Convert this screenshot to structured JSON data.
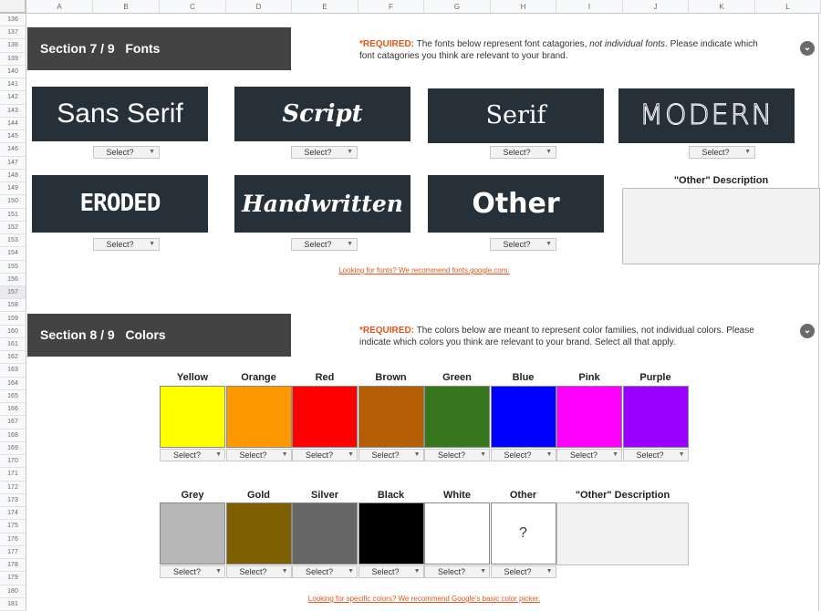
{
  "spreadsheet": {
    "columns": [
      "A",
      "B",
      "C",
      "D",
      "E",
      "F",
      "G",
      "H",
      "I",
      "J",
      "K",
      "L"
    ],
    "rows": [
      "136",
      "137",
      "138",
      "139",
      "140",
      "141",
      "142",
      "143",
      "144",
      "145",
      "146",
      "147",
      "148",
      "149",
      "150",
      "151",
      "152",
      "153",
      "154",
      "155",
      "156",
      "157",
      "158",
      "159",
      "160",
      "161",
      "162",
      "163",
      "164",
      "165",
      "166",
      "167",
      "168",
      "169",
      "170",
      "171",
      "172",
      "173",
      "174",
      "175",
      "176",
      "177",
      "178",
      "179",
      "180",
      "181"
    ],
    "selected_row": "157"
  },
  "fonts_section": {
    "title": "Section 7 / 9   Fonts",
    "required_label": "*REQUIRED:",
    "required_text_1": " The fonts below represent font catagories, ",
    "required_text_italic": "not individual fonts",
    "required_text_2": ". Please indicate which font catagories you think are relevant to your brand.",
    "expand_icon": "chevron-down-circle-icon",
    "categories": [
      {
        "label": "Sans Serif",
        "select": "Select?"
      },
      {
        "label": "Script",
        "select": "Select?"
      },
      {
        "label": "Serif",
        "select": "Select?"
      },
      {
        "label": "MODERN",
        "select": "Select?"
      },
      {
        "label": "ERODED",
        "select": "Select?"
      },
      {
        "label": "Handwritten",
        "select": "Select?"
      },
      {
        "label": "Other",
        "select": "Select?"
      }
    ],
    "other_description_title": "\"Other\" Description",
    "other_description_value": "",
    "link_text": "Looking for fonts? We recommend fonts.google.com."
  },
  "colors_section": {
    "title": "Section 8 / 9   Colors",
    "required_label": "*REQUIRED:",
    "required_text": " The colors below are meant to represent color families, not individual colors. Please indicate which colors you think are relevant to your brand. Select all that apply.",
    "expand_icon": "chevron-down-circle-icon",
    "row1": [
      {
        "name": "Yellow",
        "color": "#ffff00",
        "select": "Select?"
      },
      {
        "name": "Orange",
        "color": "#ff9900",
        "select": "Select?"
      },
      {
        "name": "Red",
        "color": "#ff0000",
        "select": "Select?"
      },
      {
        "name": "Brown",
        "color": "#b45f06",
        "select": "Select?"
      },
      {
        "name": "Green",
        "color": "#38761d",
        "select": "Select?"
      },
      {
        "name": "Blue",
        "color": "#0000ff",
        "select": "Select?"
      },
      {
        "name": "Pink",
        "color": "#ff00ff",
        "select": "Select?"
      },
      {
        "name": "Purple",
        "color": "#9900ff",
        "select": "Select?"
      }
    ],
    "row2": [
      {
        "name": "Grey",
        "color": "#b7b7b7",
        "select": "Select?"
      },
      {
        "name": "Gold",
        "color": "#7f6000",
        "select": "Select?"
      },
      {
        "name": "Silver",
        "color": "#666666",
        "select": "Select?"
      },
      {
        "name": "Black",
        "color": "#000000",
        "select": "Select?"
      },
      {
        "name": "White",
        "color": "#ffffff",
        "select": "Select?"
      },
      {
        "name": "Other",
        "color": "#ffffff",
        "symbol": "?",
        "select": "Select?"
      }
    ],
    "other_description_title": "\"Other\" Description",
    "other_description_value": "",
    "link_text": "Looking for specific colors? We recommend Google's basic color picker."
  },
  "colors": {
    "section_bg": "#434343",
    "font_card_bg": "#263039",
    "required_accent": "#e0561b"
  }
}
